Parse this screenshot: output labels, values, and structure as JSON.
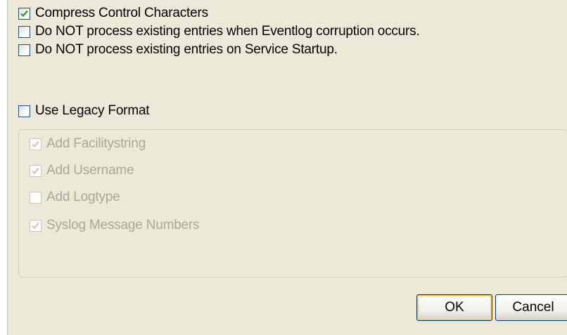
{
  "options": {
    "compress_control_characters": {
      "label": "Compress Control Characters",
      "checked": true
    },
    "skip_on_eventlog_corruption": {
      "label": "Do NOT process existing entries when Eventlog corruption occurs.",
      "checked": false
    },
    "skip_on_service_startup": {
      "label": "Do NOT process existing entries on Service Startup.",
      "checked": false
    },
    "use_legacy_format": {
      "label": "Use Legacy Format",
      "checked": false
    }
  },
  "legacy_group": {
    "items": [
      {
        "label": "Add Facilitystring",
        "checked": true,
        "enabled": false
      },
      {
        "label": "Add Username",
        "checked": true,
        "enabled": false
      },
      {
        "label": "Add Logtype",
        "checked": false,
        "enabled": false
      },
      {
        "label": "Syslog Message Numbers",
        "checked": true,
        "enabled": false
      }
    ]
  },
  "buttons": {
    "ok_label": "OK",
    "cancel_label": "Cancel"
  },
  "colors": {
    "dialog_background": "#ece9d8",
    "checkbox_border": "#1c5180",
    "checkmark": "#21a121",
    "disabled_text": "#aca899",
    "disabled_checkmark": "#cac8bb",
    "default_button_highlight": "#f8b33a"
  }
}
